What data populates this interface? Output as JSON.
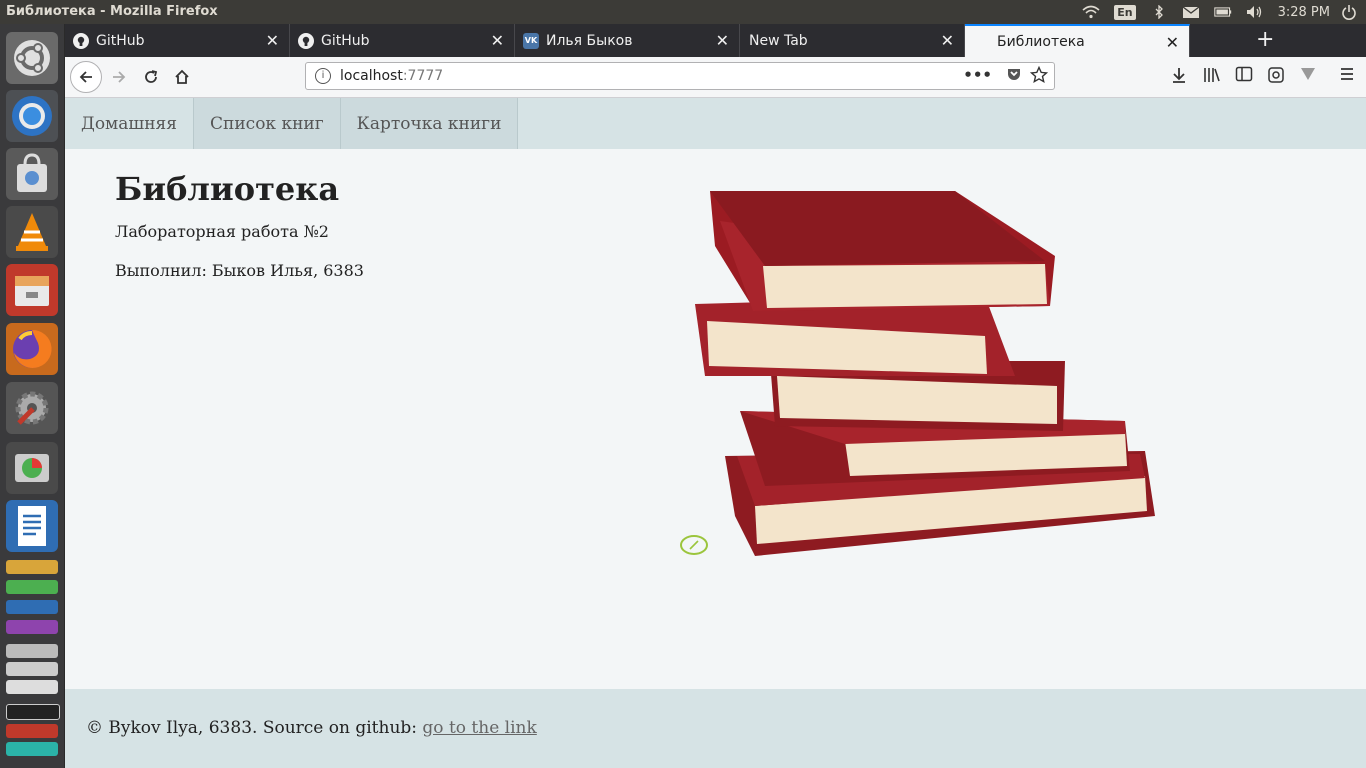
{
  "window": {
    "title": "Библиотека - Mozilla Firefox"
  },
  "tray": {
    "keyboard": "En",
    "time": "3:28 PM"
  },
  "tabs": [
    {
      "label": "GitHub",
      "icon": "github-icon"
    },
    {
      "label": "GitHub",
      "icon": "github-icon"
    },
    {
      "label": "Илья Быков",
      "icon": "vk-icon"
    },
    {
      "label": "New Tab",
      "icon": ""
    },
    {
      "label": "Библиотека",
      "icon": "",
      "active": true
    }
  ],
  "urlbar": {
    "host": "localhost",
    "port": ":7777"
  },
  "site": {
    "nav": [
      "Домашняя",
      "Список книг",
      "Карточка книги"
    ],
    "title": "Библиотека",
    "subtitle": "Лабораторная работа №2",
    "author": "Выполнил: Быков Илья, 6383",
    "footer_text": "© Bykov Ilya, 6383. Source on github:",
    "footer_link": "go to the link"
  },
  "colors": {
    "accent": "#0a84ff",
    "nav_bg": "#d6e3e5",
    "page_bg": "#f3f6f7",
    "book_red": "#9b1b22"
  }
}
